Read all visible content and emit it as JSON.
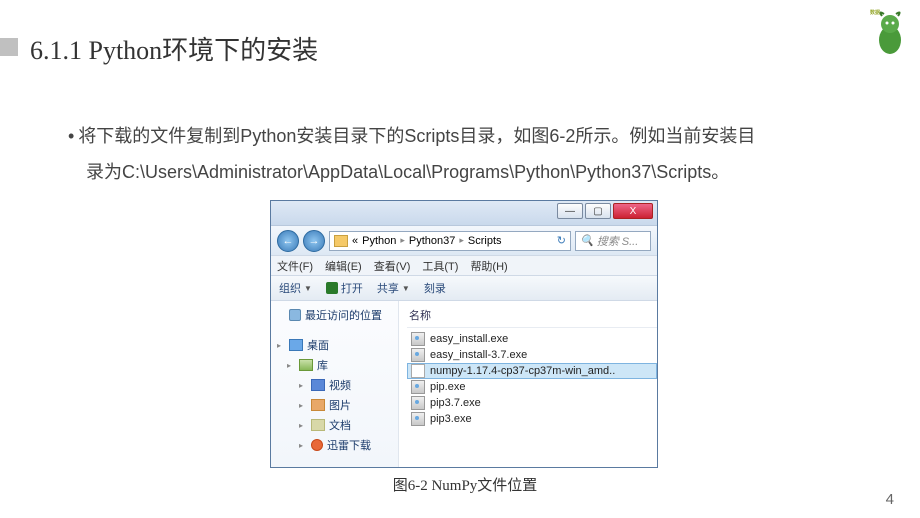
{
  "heading": "6.1.1 Python环境下的安装",
  "body": {
    "bullet": "•",
    "line1": "将下载的文件复制到Python安装目录下的Scripts目录，如图6-2所示。例如当前安装目",
    "line2": "录为C:\\Users\\Administrator\\AppData\\Local\\Programs\\Python\\Python37\\Scripts。"
  },
  "window": {
    "titlebar": {
      "min": "—",
      "max": "▢",
      "close": "X"
    },
    "nav": {
      "back": "←",
      "fwd": "→"
    },
    "address": {
      "seg1": "«",
      "seg2": "Python",
      "seg3": "Python37",
      "seg4": "Scripts",
      "sep": "▸",
      "refresh": "↻"
    },
    "search": {
      "icon": "🔍",
      "placeholder": "搜索 S..."
    },
    "menu": {
      "file": "文件(F)",
      "edit": "编辑(E)",
      "view": "查看(V)",
      "tools": "工具(T)",
      "help": "帮助(H)"
    },
    "toolbar": {
      "organize": "组织",
      "open": "打开",
      "share": "共享",
      "burn": "刻录"
    },
    "navpane": {
      "recent": "最近访问的位置",
      "desktop": "桌面",
      "libraries": "库",
      "videos": "视频",
      "pictures": "图片",
      "documents": "文档",
      "xunlei": "迅雷下载"
    },
    "files": {
      "col_name": "名称",
      "f1": "easy_install.exe",
      "f2": "easy_install-3.7.exe",
      "f3": "numpy-1.17.4-cp37-cp37m-win_amd..",
      "f4": "pip.exe",
      "f5": "pip3.7.exe",
      "f6": "pip3.exe"
    }
  },
  "caption": "图6-2  NumPy文件位置",
  "page_number": "4"
}
